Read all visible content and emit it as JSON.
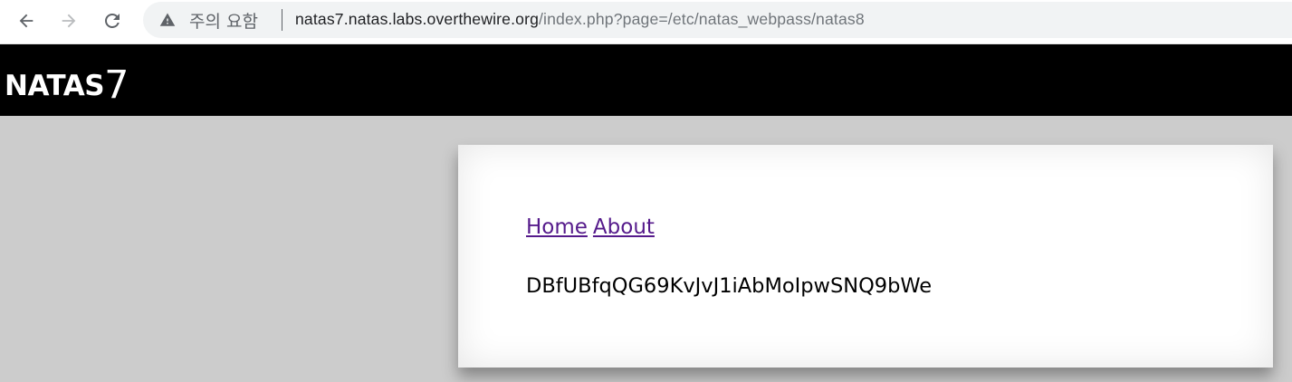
{
  "browser": {
    "back_icon": "arrow-left-icon",
    "forward_icon": "arrow-right-icon",
    "reload_icon": "reload-icon",
    "security_icon": "warning-triangle-icon",
    "security_label": "주의 요함",
    "url_host": "natas7.natas.labs.overthewire.org",
    "url_path": "/index.php?page=/etc/natas_webpass/natas8"
  },
  "header": {
    "title_word": "NATAS",
    "title_number": "7"
  },
  "content": {
    "nav": {
      "home_label": "Home",
      "about_label": "About"
    },
    "output_text": "DBfUBfqQG69KvJvJ1iAbMoIpwSNQ9bWe"
  },
  "colors": {
    "header_bg": "#000000",
    "page_bg": "#cccccc",
    "link_visited": "#551a8b",
    "panel_bg": "#ffffff"
  }
}
